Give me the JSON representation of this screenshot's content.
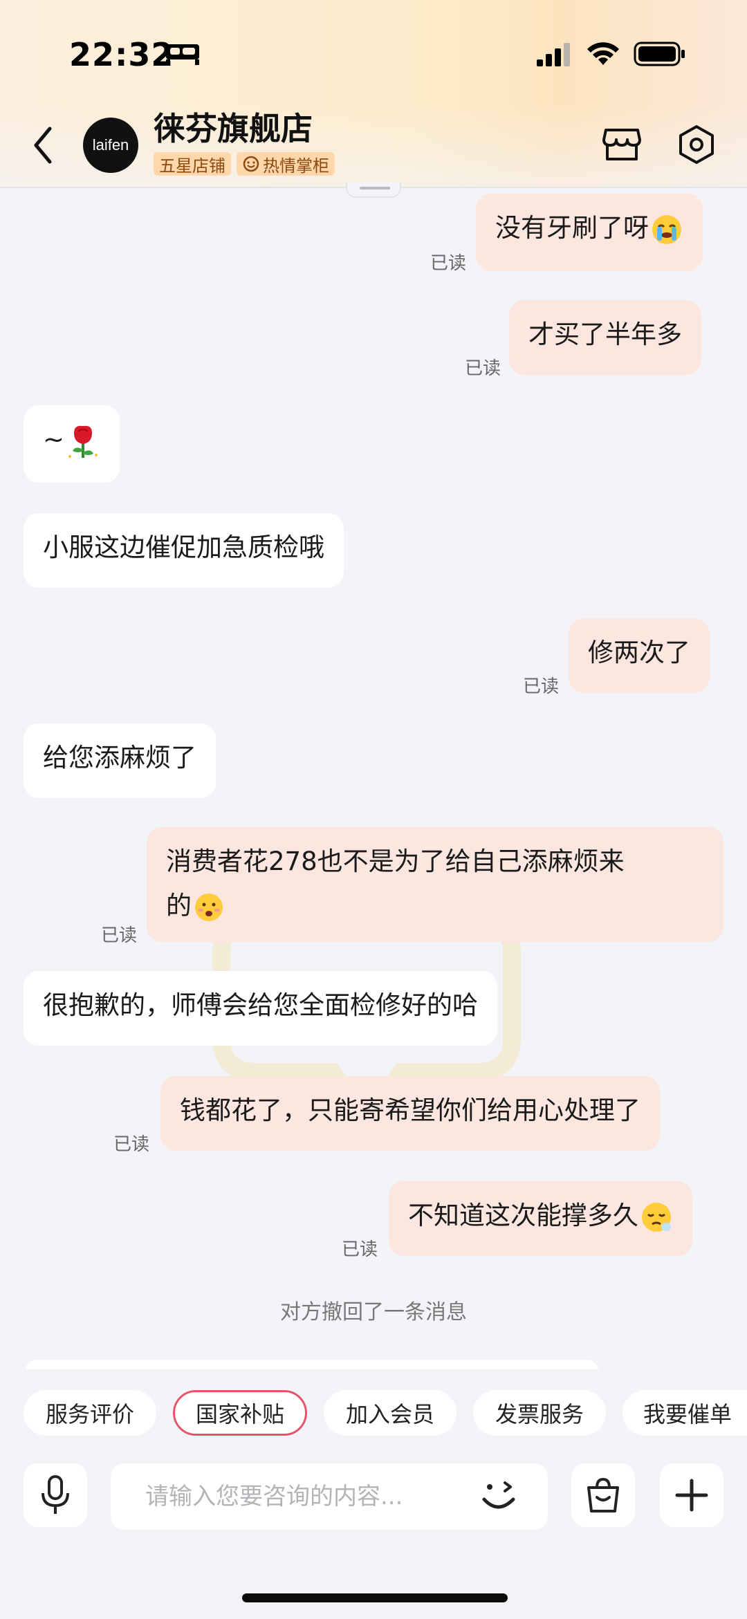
{
  "status_bar": {
    "time": "22:32"
  },
  "header": {
    "store_name": "徕芬旗舰店",
    "avatar_text": "laifen",
    "badges": [
      "五星店铺",
      "热情掌柜"
    ]
  },
  "messages": [
    {
      "side": "out",
      "text": "没有牙刷了呀",
      "emoji": "crying",
      "read": "已读"
    },
    {
      "side": "out",
      "text": "才买了半年多",
      "read": "已读"
    },
    {
      "side": "in",
      "text": "~",
      "emoji": "rose"
    },
    {
      "side": "in",
      "text": "小服这边催促加急质检哦"
    },
    {
      "side": "out",
      "text": "修两次了",
      "read": "已读"
    },
    {
      "side": "in",
      "text": "给您添麻烦了"
    },
    {
      "side": "out",
      "text": "消费者花278也不是为了给自己添麻烦来",
      "text_line2": "的",
      "emoji": "sad",
      "read": "已读"
    },
    {
      "side": "in",
      "text": "很抱歉的，师傅会给您全面检修好的哈"
    },
    {
      "side": "out",
      "text": "钱都花了，只能寄希望你们给用心处理了",
      "read": "已读"
    },
    {
      "side": "out",
      "text": "不知道这次能撑多久",
      "emoji": "sleepy",
      "read": "已读"
    }
  ],
  "recall_notice": "对方撤回了一条消息",
  "quick_actions": [
    "服务评价",
    "国家补贴",
    "加入会员",
    "发票服务",
    "我要催单"
  ],
  "input": {
    "placeholder": "请输入您要咨询的内容..."
  },
  "colors": {
    "out_bubble": "#fbe6e0",
    "in_bubble": "#ffffff",
    "accent": "#e2556a",
    "badge_bg": "#ffd7aa"
  }
}
